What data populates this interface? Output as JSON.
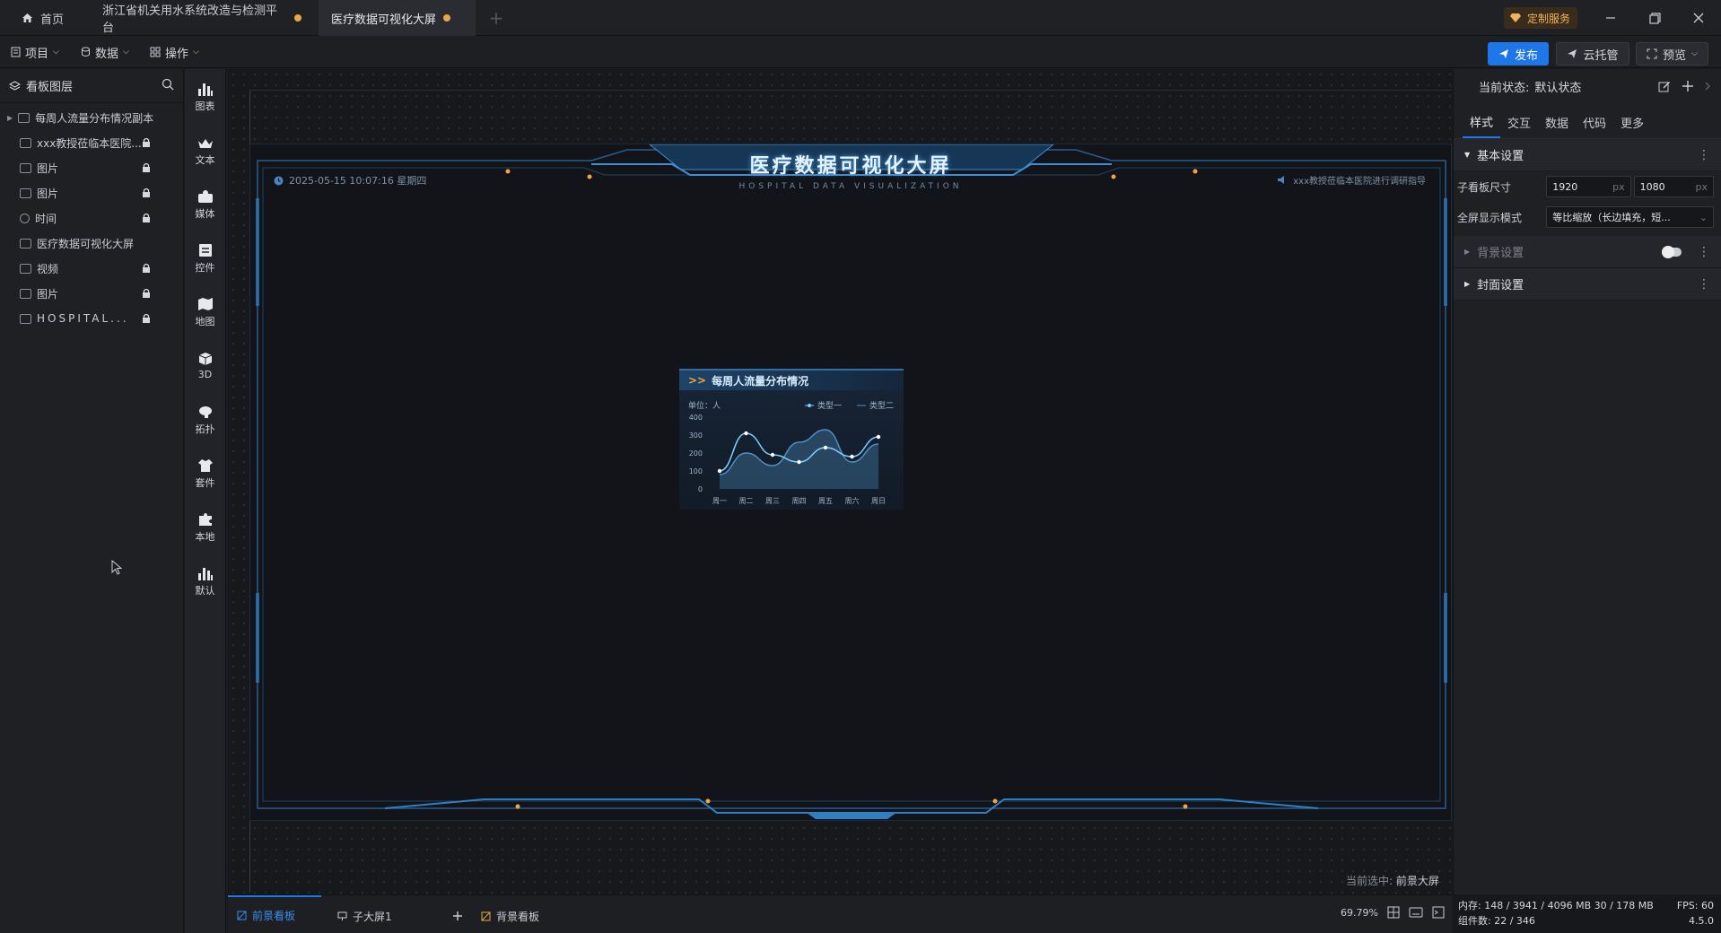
{
  "tabs": {
    "home": "首页",
    "tab1": "浙江省机关用水系统改造与检测平台",
    "tab2": "医疗数据可视化大屏",
    "add": "+"
  },
  "header": {
    "custom_service": "定制服务"
  },
  "toolbar": {
    "project": "项目",
    "data": "数据",
    "operate": "操作",
    "publish": "发布",
    "cloud": "云托管",
    "preview": "预览"
  },
  "layers": {
    "title": "看板图层",
    "items": [
      {
        "label": "每周人流量分布情况副本",
        "locked": false
      },
      {
        "label": "xxx教授莅临本医院...",
        "locked": true
      },
      {
        "label": "图片",
        "locked": true
      },
      {
        "label": "图片",
        "locked": true
      },
      {
        "label": "时间",
        "locked": true
      },
      {
        "label": "医疗数据可视化大屏",
        "locked": false
      },
      {
        "label": "视频",
        "locked": true
      },
      {
        "label": "图片",
        "locked": true
      },
      {
        "label": "HOSPITAL...",
        "locked": true
      }
    ]
  },
  "components": [
    "图表",
    "文本",
    "媒体",
    "控件",
    "地图",
    "3D",
    "拓扑",
    "套件",
    "本地",
    "默认"
  ],
  "screen": {
    "title": "医疗数据可视化大屏",
    "subtitle": "HOSPITAL DATA VISUALIZATION",
    "datetime": "2025-05-15 10:07:16 星期四",
    "notice": "xxx教授莅临本医院进行调研指导",
    "current_selection_label": "当前选中:",
    "current_selection_value": "前景大屏"
  },
  "chart_data": {
    "type": "line",
    "title": "每周人流量分布情况",
    "unit_label": "单位：人",
    "categories": [
      "周一",
      "周二",
      "周三",
      "周四",
      "周五",
      "周六",
      "周日"
    ],
    "series": [
      {
        "name": "类型一",
        "values": [
          100,
          310,
          190,
          150,
          230,
          180,
          290
        ],
        "color": "#7fd0ff"
      },
      {
        "name": "类型二",
        "values": [
          80,
          200,
          130,
          260,
          330,
          150,
          250
        ],
        "color": "#4e8fc4"
      }
    ],
    "yticks": [
      0,
      100,
      200,
      300,
      400
    ],
    "ylim": [
      0,
      400
    ]
  },
  "right_panel": {
    "state_label": "当前状态:",
    "state_value": "默认状态",
    "tabs": [
      "样式",
      "交互",
      "数据",
      "代码",
      "更多"
    ],
    "basic": "基本设置",
    "size_label": "子看板尺寸",
    "width": "1920",
    "height": "1080",
    "unit": "px",
    "mode_label": "全屏显示模式",
    "mode_value": "等比缩放（长边填充，短...",
    "background": "背景设置",
    "cover": "封面设置"
  },
  "bottom": {
    "tab_front": "前景看板",
    "tab_sub": "子大屏1",
    "tab_back": "背景看板",
    "zoom": "69.79%",
    "memory": "内存: 148 / 3941 / 4096 MB  30 / 178 MB",
    "components": "组件数: 22 / 346",
    "fps": "FPS:  60",
    "version": "4.5.0"
  },
  "colors": {
    "accent": "#1e77e8",
    "frame": "#2f7fc4",
    "orange": "#f0a540"
  }
}
